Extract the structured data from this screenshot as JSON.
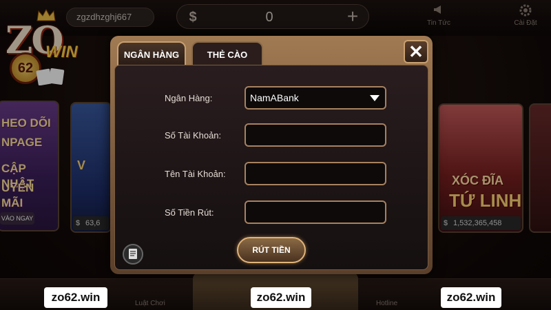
{
  "topbar": {
    "username": "zgzdhzghj667",
    "balance": "0",
    "news_label": "Tin Tức",
    "settings_label": "Cài Đặt"
  },
  "logo": {
    "brand": "ZO",
    "number": "62",
    "suffix": "WIN"
  },
  "background": {
    "fanpage_lines": [
      "HEO DÕI",
      "NPAGE",
      "CẬP NHẬT",
      "UYẾN MÃI"
    ],
    "fanpage_button": "VÀO NGAY",
    "euro_amount": "63,6",
    "xocdia_line1": "XÓC ĐĨA",
    "xocdia_line2": "TỨ LINH",
    "xocdia_amount": "1,532,365,458"
  },
  "bottombar": {
    "rules_label": "Luật Chơi",
    "hotline_label": "Hotline"
  },
  "watermarks": [
    "zo62.win",
    "zo62.win",
    "zo62.win"
  ],
  "modal": {
    "tabs": [
      {
        "label": "NGÂN HÀNG",
        "active": true
      },
      {
        "label": "THẺ CÀO",
        "active": false
      }
    ],
    "close_symbol": "✕",
    "fields": {
      "bank": {
        "label": "Ngân Hàng:",
        "value": "NamABank"
      },
      "account_number": {
        "label": "Số Tài Khoản:",
        "value": ""
      },
      "account_name": {
        "label": "Tên Tài Khoản:",
        "value": ""
      },
      "amount": {
        "label": "Số Tiền Rút:",
        "value": ""
      }
    },
    "submit_label": "RÚT TIỀN"
  },
  "colors": {
    "accent_gold": "#c9a070",
    "panel_bg": "#1c1415"
  }
}
